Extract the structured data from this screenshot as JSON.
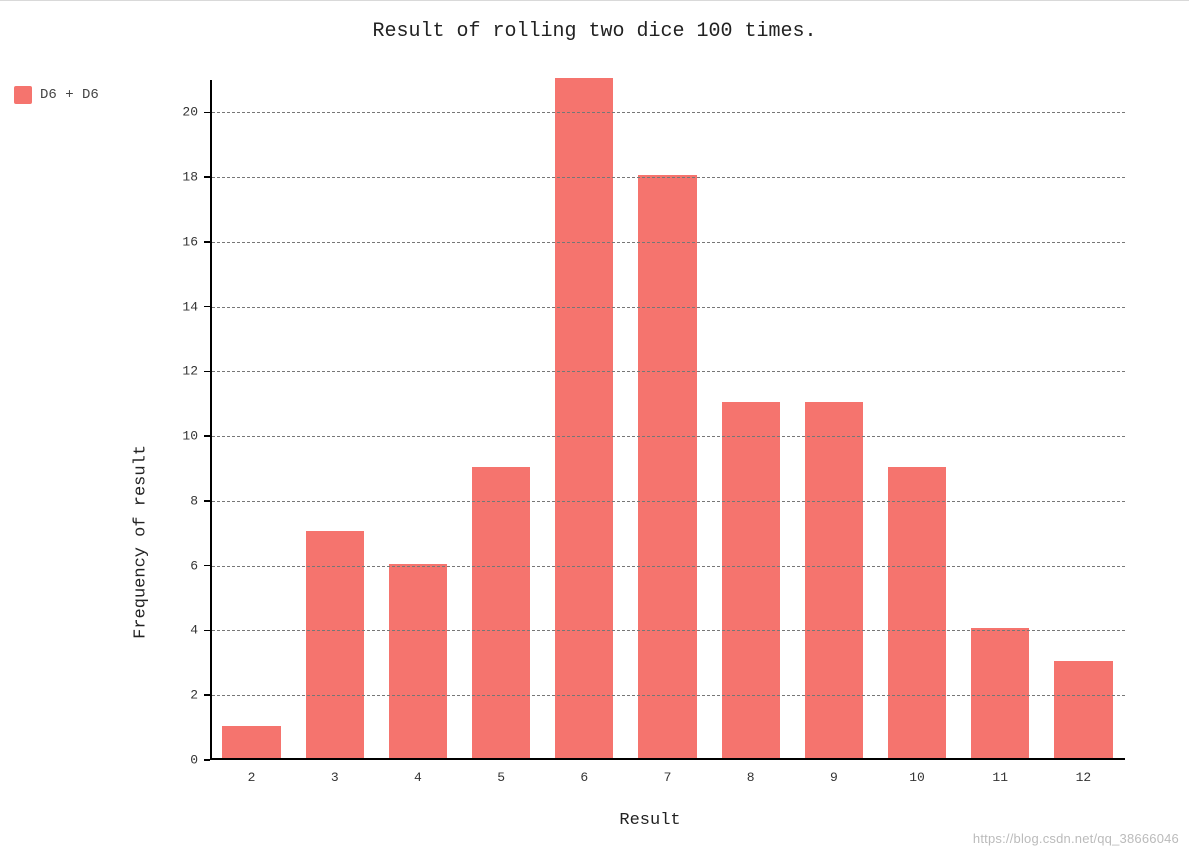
{
  "chart_data": {
    "type": "bar",
    "title": "Result of rolling two dice 100 times.",
    "xlabel": "Result",
    "ylabel": "Frequency of result",
    "categories": [
      "2",
      "3",
      "4",
      "5",
      "6",
      "7",
      "8",
      "9",
      "10",
      "11",
      "12"
    ],
    "values": [
      1,
      7,
      6,
      9,
      21,
      18,
      11,
      11,
      9,
      4,
      3
    ],
    "ylim": [
      0,
      21
    ],
    "y_ticks": [
      0,
      2,
      4,
      6,
      8,
      10,
      12,
      14,
      16,
      18,
      20
    ],
    "series": [
      {
        "name": "D6 + D6",
        "color": "#f5746e"
      }
    ],
    "grid": true,
    "legend_position": "left-top"
  },
  "legend": {
    "label": "D6 + D6"
  },
  "watermark": "https://blog.csdn.net/qq_38666046"
}
